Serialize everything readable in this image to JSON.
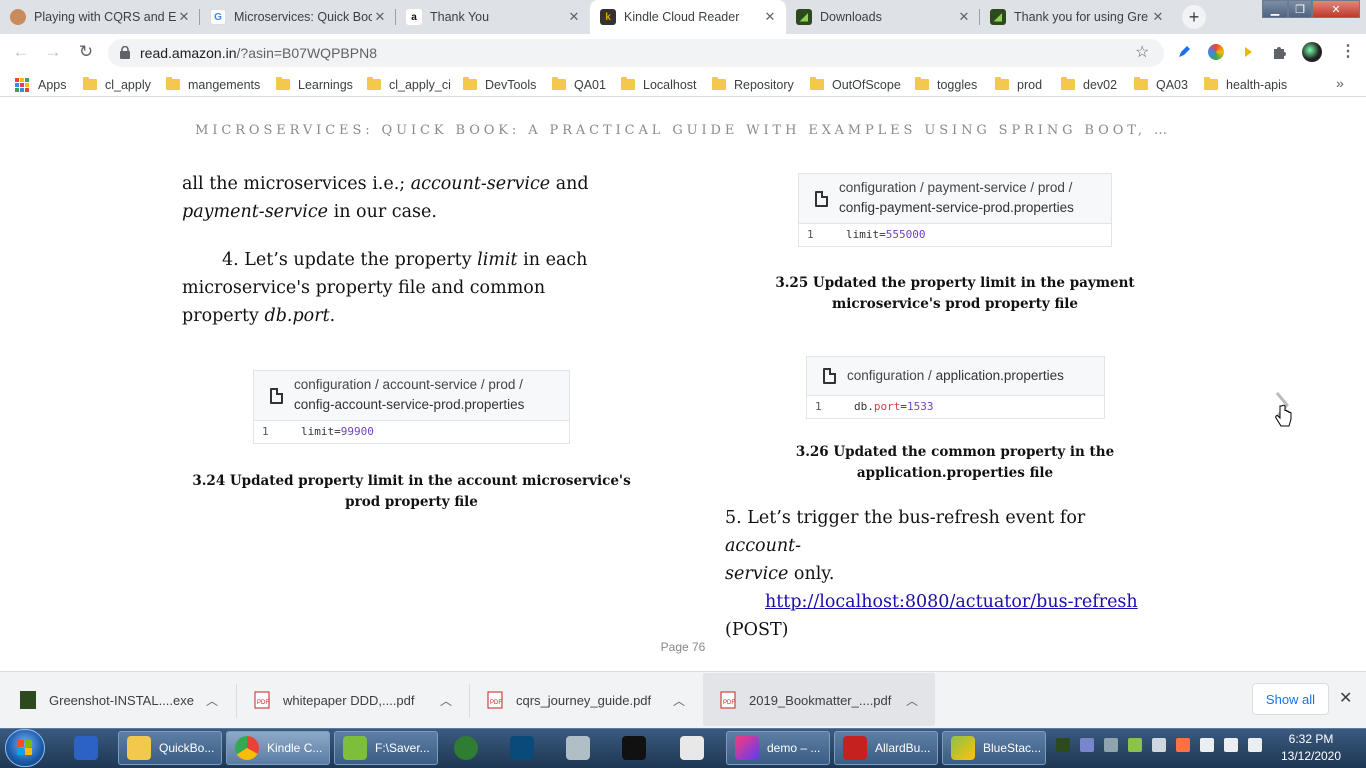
{
  "tabs": [
    {
      "title": "Playing with CQRS and E",
      "active": false
    },
    {
      "title": "Microservices: Quick Boo",
      "active": false
    },
    {
      "title": "Thank You",
      "active": false
    },
    {
      "title": "Kindle Cloud Reader",
      "active": true
    },
    {
      "title": "Downloads",
      "active": false
    },
    {
      "title": "Thank you for using Gre",
      "active": false
    }
  ],
  "toolbar": {
    "url_host": "read.amazon.in",
    "url_path": "/?asin=B07WQPBPN8"
  },
  "bookmarks": {
    "apps_label": "Apps",
    "items": [
      "cl_apply",
      "mangements",
      "Learnings",
      "cl_apply_ci",
      "DevTools",
      "QA01",
      "Localhost",
      "Repository",
      "OutOfScope",
      "toggles",
      "prod",
      "dev02",
      "QA03",
      "health-apis"
    ],
    "more": "»"
  },
  "reader": {
    "book_title": "MICROSERVICES: QUICK BOOK: A PRACTICAL GUIDE WITH EXAMPLES USING SPRING BOOT, …",
    "left": {
      "p1_a": "all the microservices i.e.; ",
      "p1_b": "account-service",
      "p1_c": " and",
      "p1_d": "payment-service",
      "p1_e": " in our case.",
      "p2_a": "4. Let’s update the property ",
      "p2_b": "limit",
      "p2_c": " in each",
      "p2_d": "microservice's property file and common",
      "p2_e": "property ",
      "p2_f": "db.port",
      "p2_g": ".",
      "code": {
        "path": "configuration  /  account-service  /  prod  /",
        "file": "config-account-service-prod.properties",
        "line_no": "1",
        "key": "limit=",
        "value": "99900"
      },
      "caption_1": "3.24 Updated property limit in the account microservice's",
      "caption_2": "prod property file"
    },
    "right": {
      "code1": {
        "path": "configuration  /  payment-service  /  prod  /",
        "file": "config-payment-service-prod.properties",
        "line_no": "1",
        "key": "limit=",
        "value": "555000"
      },
      "caption1_1": "3.25 Updated the property limit in the payment",
      "caption1_2": "microservice's prod property file",
      "code2": {
        "path": "configuration  /  ",
        "file": "application.properties",
        "line_no": "1",
        "key_a": "db.",
        "key_b": "port",
        "key_c": "=",
        "value": "1533"
      },
      "caption2_1": "3.26 Updated the common property in the",
      "caption2_2": "application.properties file",
      "p5_a": "5. Let’s trigger the bus-refresh event for ",
      "p5_b": "account-",
      "p5_c": "service",
      "p5_d": " only.",
      "link": "http://localhost:8080/actuator/bus-refresh",
      "post": "(POST)"
    },
    "page_label": "Page 76"
  },
  "downloads": {
    "items": [
      "Greenshot-INSTAL....exe",
      "whitepaper DDD,....pdf",
      "cqrs_journey_guide.pdf",
      "2019_Bookmatter_....pdf"
    ],
    "show_all": "Show all",
    "close": "✕"
  },
  "taskbar": {
    "items": [
      "QuickBo...",
      "Kindle C...",
      "F:\\Saver...",
      "demo – ...",
      "AllardBu...",
      "BlueStac..."
    ],
    "time": "6:32 PM",
    "date": "13/12/2020"
  },
  "colors": {
    "accent": "#1a73e8",
    "link": "#1a0dab",
    "code_number": "#6f42c1",
    "tabstrip": "#dee1e6"
  }
}
